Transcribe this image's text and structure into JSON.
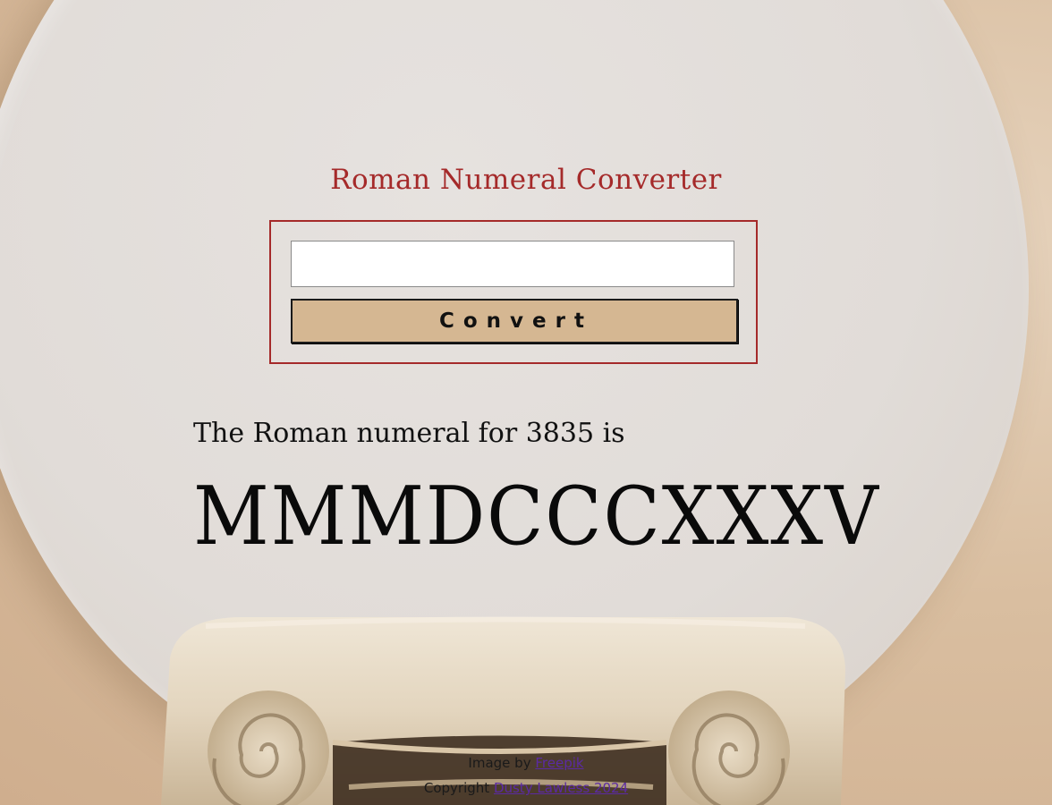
{
  "app": {
    "title": "Roman Numeral Converter"
  },
  "form": {
    "input_value": "",
    "input_placeholder": "",
    "convert_label": "Convert"
  },
  "result": {
    "label": "The Roman numeral for 3835 is",
    "value": "MMMDCCCXXXV"
  },
  "footer": {
    "image_credit_prefix": "Image by",
    "image_credit_link": "Freepik",
    "copyright_prefix": "Copyright",
    "copyright_link": "Dusty Lawless 2024"
  },
  "colors": {
    "accent": "#a52a2a",
    "button_bg": "#d5b792",
    "link": "#5b2aa3"
  }
}
